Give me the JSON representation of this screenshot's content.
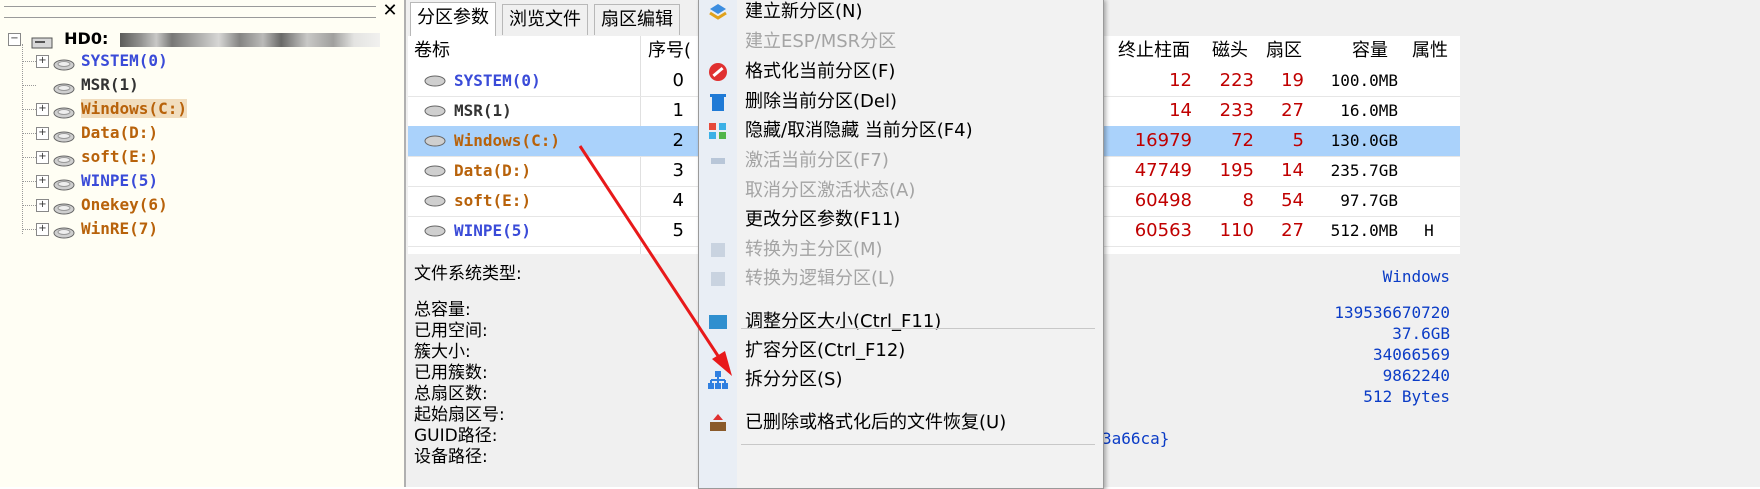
{
  "tree": {
    "root_label": "HD0:",
    "close_glyph": "✕",
    "nodes": [
      {
        "label": "SYSTEM(0)",
        "color": "#3a4bd8",
        "expand": "+"
      },
      {
        "label": "MSR(1)",
        "color": "#333333",
        "expand": ""
      },
      {
        "label": "Windows(C:)",
        "color": "#b8620a",
        "expand": "+"
      },
      {
        "label": "Data(D:)",
        "color": "#b8620a",
        "expand": "+"
      },
      {
        "label": "soft(E:)",
        "color": "#b8620a",
        "expand": "+"
      },
      {
        "label": "WINPE(5)",
        "color": "#3a4bd8",
        "expand": "+"
      },
      {
        "label": "Onekey(6)",
        "color": "#b8620a",
        "expand": "+"
      },
      {
        "label": "WinRE(7)",
        "color": "#b8620a",
        "expand": "+"
      }
    ]
  },
  "tabs": [
    "分区参数",
    "浏览文件",
    "扇区编辑"
  ],
  "table": {
    "headers": {
      "volume": "卷标",
      "index": "序号(",
      "end_cyl": "终止柱面",
      "heads": "磁头",
      "sector": "扇区",
      "capacity": "容量",
      "attr": "属性"
    },
    "rows": [
      {
        "name": "SYSTEM(0)",
        "name_color": "#3a4bd8",
        "index": "0",
        "end_cyl": "12",
        "heads": "223",
        "sector": "19",
        "capacity": "100.0MB",
        "attr": ""
      },
      {
        "name": "MSR(1)",
        "name_color": "#333333",
        "index": "1",
        "end_cyl": "14",
        "heads": "233",
        "sector": "27",
        "capacity": "16.0MB",
        "attr": ""
      },
      {
        "name": "Windows(C:)",
        "name_color": "#b8620a",
        "index": "2",
        "end_cyl": "16979",
        "heads": "72",
        "sector": "5",
        "capacity": "130.0GB",
        "attr": ""
      },
      {
        "name": "Data(D:)",
        "name_color": "#b8620a",
        "index": "3",
        "end_cyl": "47749",
        "heads": "195",
        "sector": "14",
        "capacity": "235.7GB",
        "attr": ""
      },
      {
        "name": "soft(E:)",
        "name_color": "#b8620a",
        "index": "4",
        "end_cyl": "60498",
        "heads": "8",
        "sector": "54",
        "capacity": "97.7GB",
        "attr": ""
      },
      {
        "name": "WINPE(5)",
        "name_color": "#3a4bd8",
        "index": "5",
        "end_cyl": "60563",
        "heads": "110",
        "sector": "27",
        "capacity": "512.0MB",
        "attr": "H"
      }
    ]
  },
  "info": {
    "fs_label": "文件系统类型:",
    "fs_value": "Windows",
    "labels": [
      "总容量:",
      "已用空间:",
      "簇大小:",
      "已用簇数:",
      "总扇区数:",
      "起始扇区号:",
      "GUID路径:",
      "设备路径:"
    ],
    "values": [
      "139536670720",
      "37.6GB",
      "34066569",
      "9862240",
      "512 Bytes"
    ],
    "guid_tail": "3a66ca}"
  },
  "menu": {
    "items": [
      {
        "label": "建立新分区(N)",
        "disabled": false,
        "icon": "new-partition-icon"
      },
      {
        "label": "建立ESP/MSR分区",
        "disabled": true,
        "icon": ""
      },
      {
        "label": "格式化当前分区(F)",
        "disabled": false,
        "icon": "format-icon"
      },
      {
        "label": "删除当前分区(Del)",
        "disabled": false,
        "icon": "delete-icon"
      },
      {
        "label": "隐藏/取消隐藏 当前分区(F4)",
        "disabled": false,
        "icon": "hide-icon"
      },
      {
        "label": "激活当前分区(F7)",
        "disabled": true,
        "icon": "activate-icon"
      },
      {
        "label": "取消分区激活状态(A)",
        "disabled": true,
        "icon": ""
      },
      {
        "label": "更改分区参数(F11)",
        "disabled": false,
        "icon": ""
      },
      {
        "label": "转换为主分区(M)",
        "disabled": true,
        "icon": "convert-primary-icon"
      },
      {
        "label": "转换为逻辑分区(L)",
        "disabled": true,
        "icon": "convert-logical-icon"
      },
      {
        "label": "调整分区大小(Ctrl_F11)",
        "disabled": false,
        "icon": "resize-icon"
      },
      {
        "label": "扩容分区(Ctrl_F12)",
        "disabled": false,
        "icon": ""
      },
      {
        "label": "拆分分区(S)",
        "disabled": false,
        "icon": "split-icon"
      },
      {
        "label": "已删除或格式化后的文件恢复(U)",
        "disabled": false,
        "icon": "recover-icon"
      }
    ]
  },
  "colors": {
    "selection": "#aad2fb",
    "accent_red": "#c00000",
    "value_blue": "#0b3cc6",
    "arrow": "#e8191a"
  }
}
